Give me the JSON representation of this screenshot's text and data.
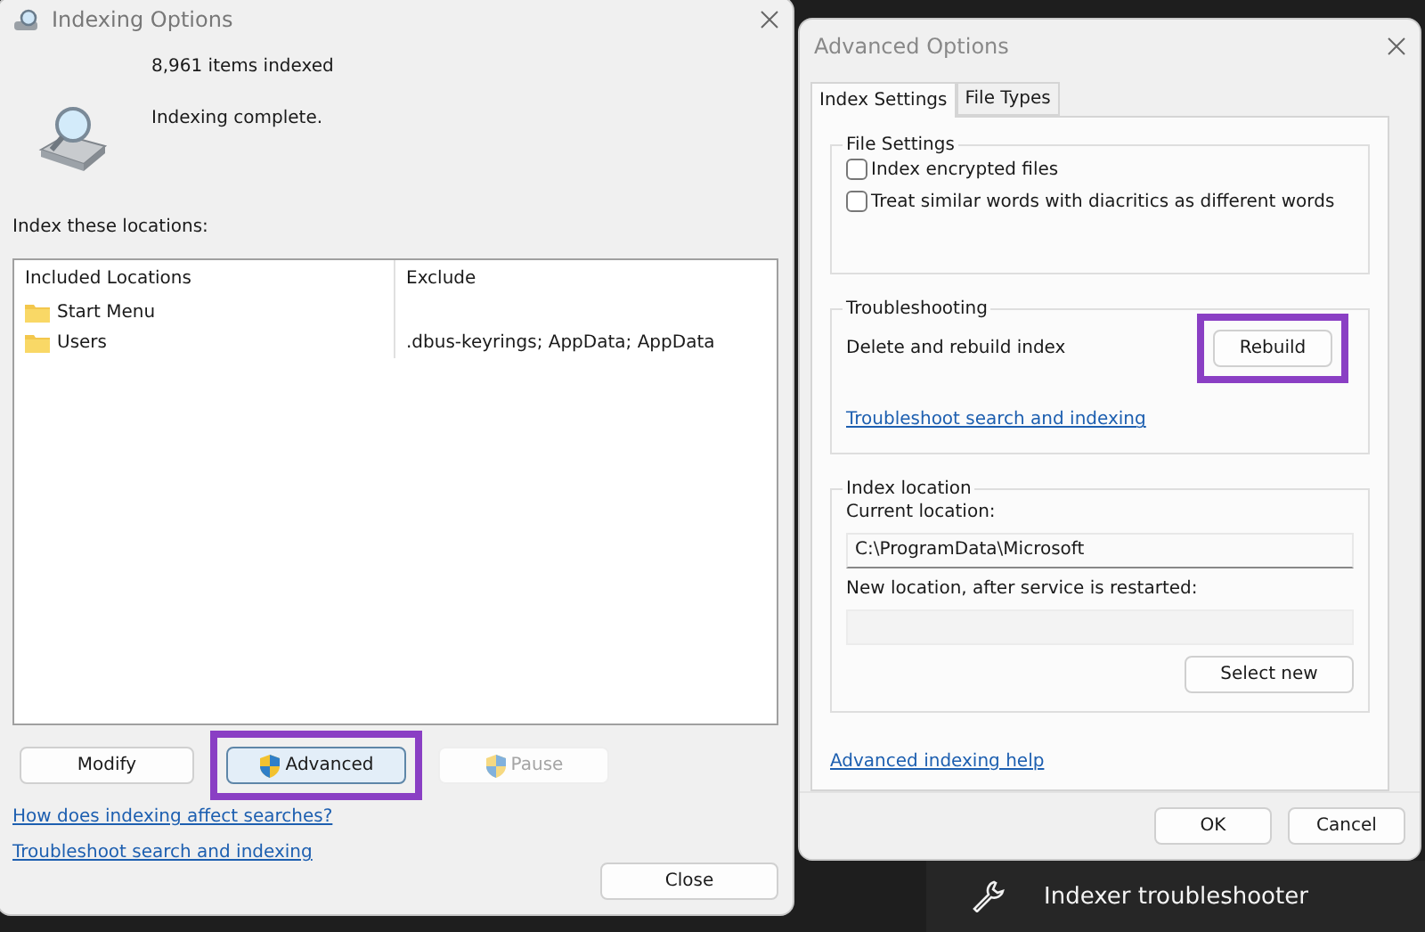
{
  "indexing_window": {
    "title": "Indexing Options",
    "items_indexed": "8,961 items indexed",
    "status": "Indexing complete.",
    "locations_label": "Index these locations:",
    "table": {
      "columns": [
        "Included Locations",
        "Exclude"
      ],
      "rows": [
        {
          "location": "Start Menu"
        },
        {
          "location": "Users",
          "exclude": ".dbus-keyrings; AppData; AppData"
        }
      ]
    },
    "buttons": [
      {
        "label": "Modify",
        "shield": false,
        "disabled": false,
        "highlighted": false
      },
      {
        "label": "Advanced",
        "shield": true,
        "disabled": false,
        "highlighted": true
      },
      {
        "label": "Pause",
        "shield": true,
        "disabled": true,
        "highlighted": false
      }
    ],
    "links": [
      "How does indexing affect searches?",
      "Troubleshoot search and indexing"
    ],
    "close_button": "Close"
  },
  "advanced_window": {
    "title": "Advanced Options",
    "tabs": [
      {
        "label": "Index Settings",
        "selected": true
      },
      {
        "label": "File Types",
        "selected": false
      }
    ],
    "file_settings": {
      "title": "File Settings",
      "options": [
        {
          "label": "Index encrypted files",
          "checked": false
        },
        {
          "label": "Treat similar words with diacritics as different words",
          "checked": false
        }
      ]
    },
    "troubleshooting": {
      "title": "Troubleshooting",
      "text": "Delete and rebuild index",
      "button": {
        "label": "Rebuild",
        "highlighted": true
      },
      "link": "Troubleshoot search and indexing"
    },
    "index_location": {
      "title": "Index location",
      "current_label": "Current location:",
      "current_value": "C:\\ProgramData\\Microsoft",
      "new_label": "New location, after service is restarted:",
      "select_button": "Select new"
    },
    "help_link": "Advanced indexing help",
    "buttons": [
      "OK",
      "Cancel"
    ]
  },
  "background_item": {
    "label": "Indexer troubleshooter"
  }
}
